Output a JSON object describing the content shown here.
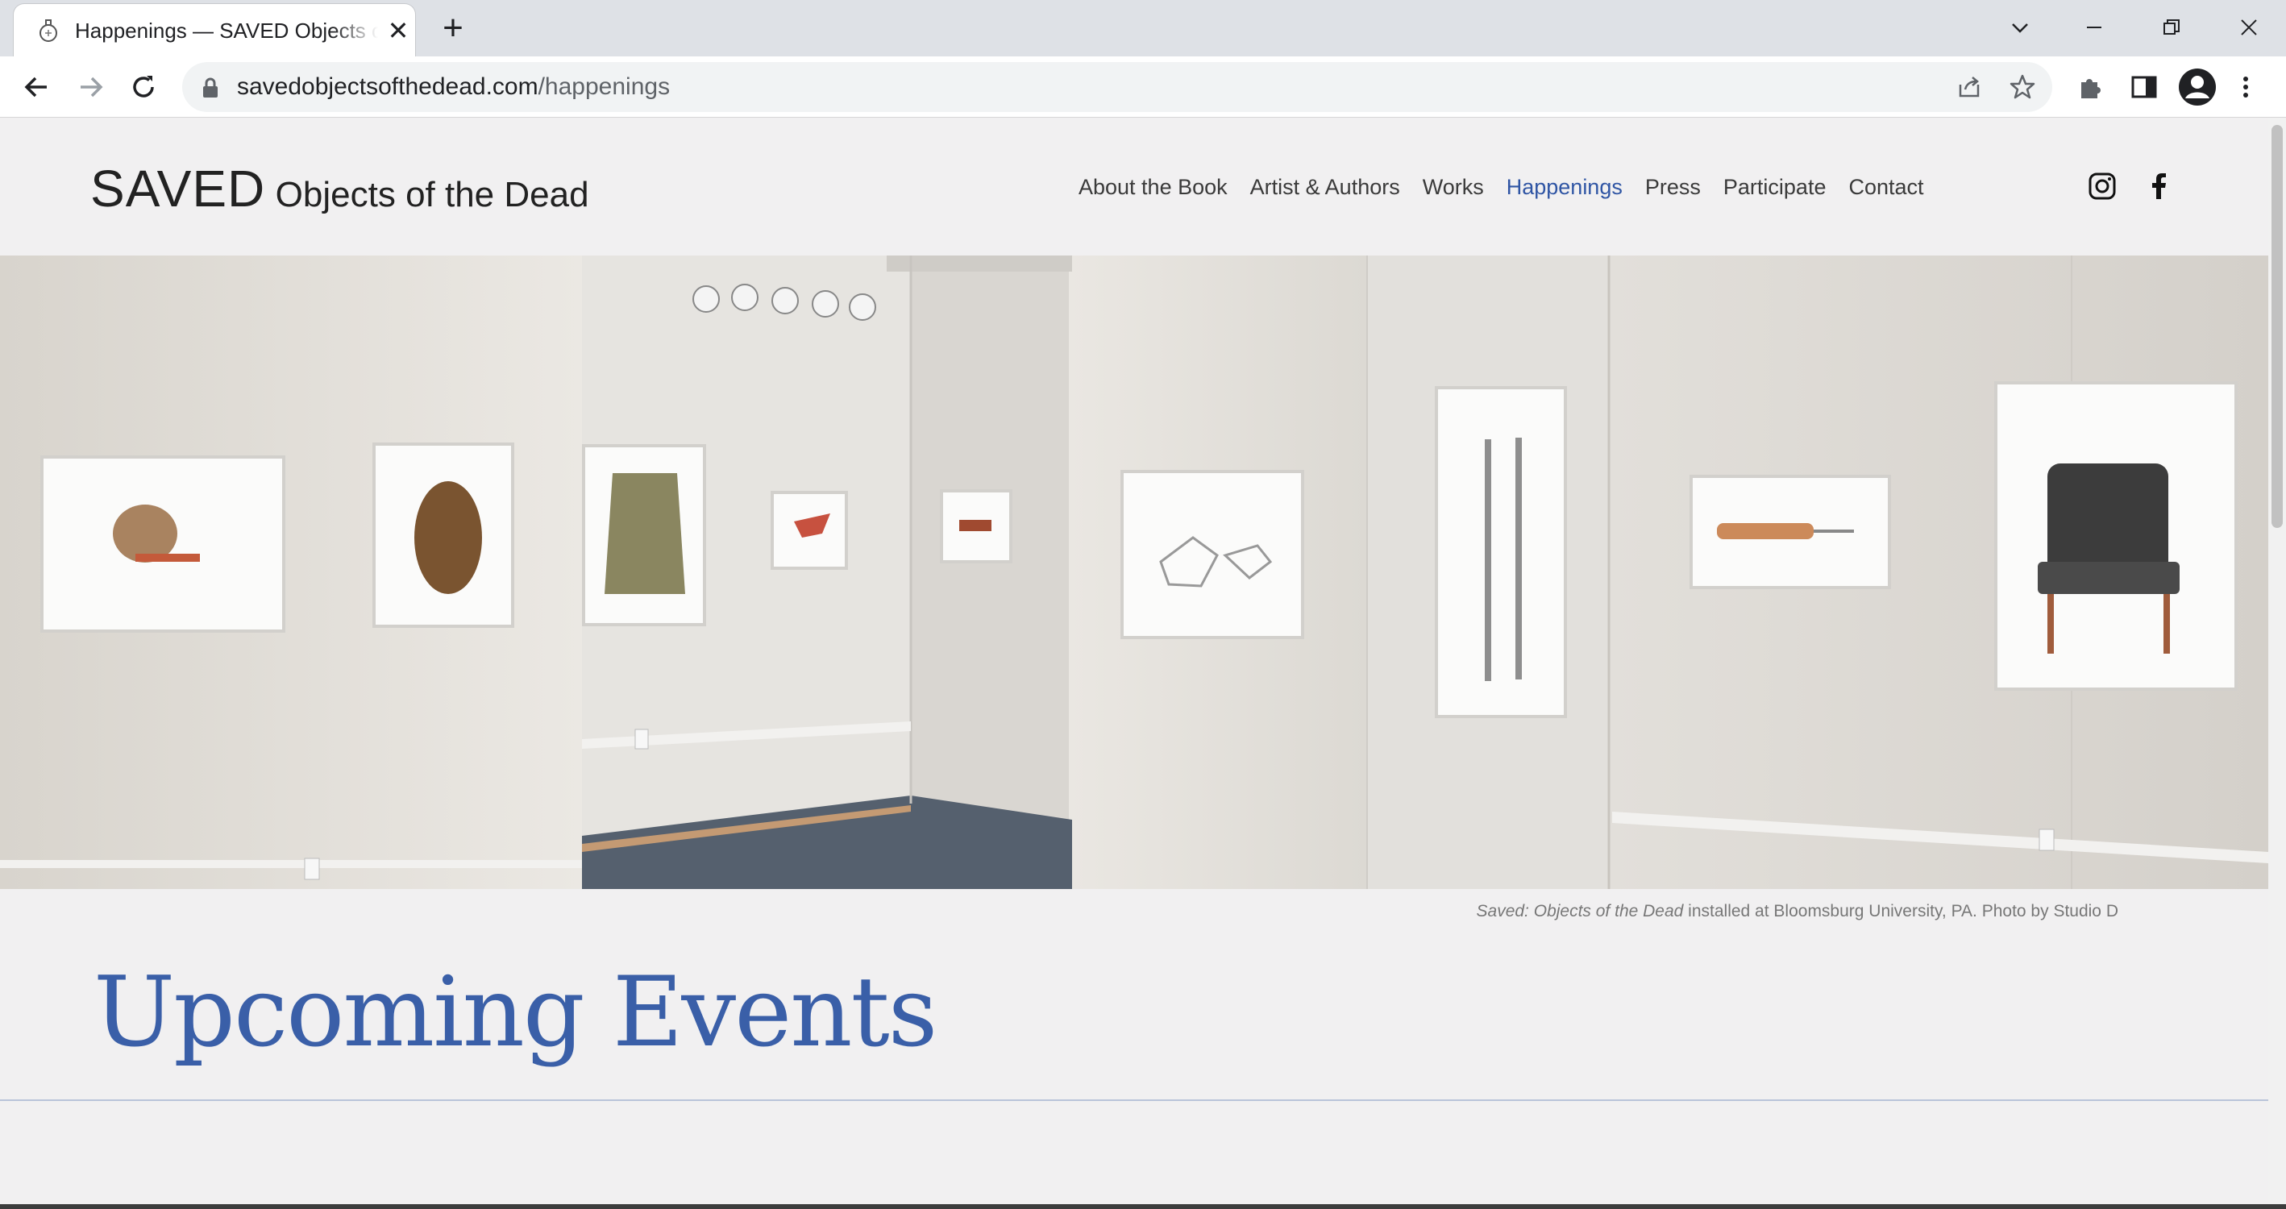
{
  "browser": {
    "tab_title": "Happenings — SAVED Objects of the Dead",
    "close_glyph": "✕",
    "new_tab_glyph": "+",
    "url_domain": "savedobjectsofthedead.com",
    "url_path": "/happenings"
  },
  "site": {
    "brand_main": "SAVED",
    "brand_sub": "Objects of the Dead",
    "nav": [
      {
        "label": "About the Book"
      },
      {
        "label": "Artist & Authors"
      },
      {
        "label": "Works"
      },
      {
        "label": "Happenings",
        "active": true
      },
      {
        "label": "Press"
      },
      {
        "label": "Participate"
      },
      {
        "label": "Contact"
      }
    ],
    "social": [
      "instagram-icon",
      "facebook-icon"
    ],
    "hero": {
      "caption_italic": "Saved: Objects of the Dead",
      "caption_rest": " installed at Bloomsburg University, PA. Photo by Studio D"
    },
    "section_title": "Upcoming Events"
  },
  "colors": {
    "accent": "#2f55a4",
    "title_blue": "#3a5fa8",
    "page_bg": "#f1f0f1",
    "chrome_bg": "#dee1e6"
  }
}
